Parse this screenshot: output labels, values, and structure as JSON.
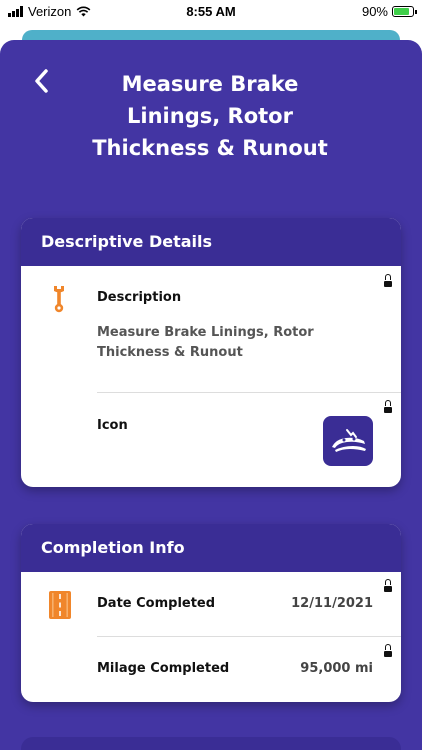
{
  "status_bar": {
    "carrier": "Verizon",
    "time": "8:55 AM",
    "battery_percent": "90%",
    "battery_level": 0.9
  },
  "header": {
    "back_icon": "chevron-left-icon",
    "title": "Measure Brake Linings, Rotor Thickness & Runout"
  },
  "descriptive_details": {
    "heading": "Descriptive Details",
    "description_label": "Description",
    "description_value": "Measure Brake Linings, Rotor Thickness & Runout",
    "description_icon": "wrench-icon",
    "icon_label": "Icon",
    "icon_image": "brake-icon"
  },
  "completion_info": {
    "heading": "Completion Info",
    "row_icon": "road-icon",
    "date_label": "Date Completed",
    "date_value": "12/11/2021",
    "mileage_label": "Milage Completed",
    "mileage_value": "95,000 mi"
  },
  "colors": {
    "background": "#4335a3",
    "card_header": "#3a2d95",
    "accent_orange": "#f0862b",
    "teal": "#4fb0c9"
  }
}
